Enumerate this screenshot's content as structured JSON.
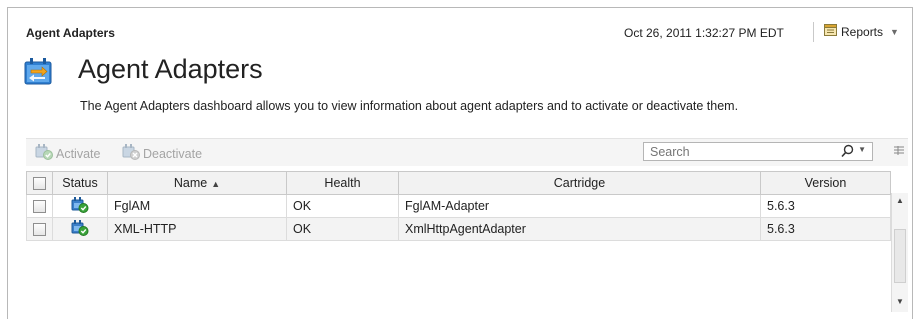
{
  "header": {
    "breadcrumb": "Agent Adapters",
    "timestamp": "Oct 26, 2011 1:32:27 PM EDT",
    "reports_label": "Reports"
  },
  "page": {
    "title": "Agent Adapters",
    "description": "The Agent Adapters dashboard allows you to view information about agent adapters and to activate or deactivate them."
  },
  "toolbar": {
    "activate_label": "Activate",
    "deactivate_label": "Deactivate",
    "search_placeholder": "Search"
  },
  "table": {
    "columns": {
      "status": "Status",
      "name": "Name",
      "health": "Health",
      "cartridge": "Cartridge",
      "version": "Version"
    },
    "sort_column": "Name",
    "sort_direction": "ascending",
    "rows": [
      {
        "name": "FglAM",
        "health": "OK",
        "cartridge": "FglAM-Adapter",
        "version": "5.6.3",
        "status_icon": "active-adapter-icon"
      },
      {
        "name": "XML-HTTP",
        "health": "OK",
        "cartridge": "XmlHttpAgentAdapter",
        "version": "5.6.3",
        "status_icon": "active-adapter-icon"
      }
    ]
  },
  "colors": {
    "accent_blue": "#2f7fd1",
    "status_green": "#3aa33a",
    "header_bg": "#f2f2f2",
    "alt_row_bg": "#f3f3f3"
  }
}
